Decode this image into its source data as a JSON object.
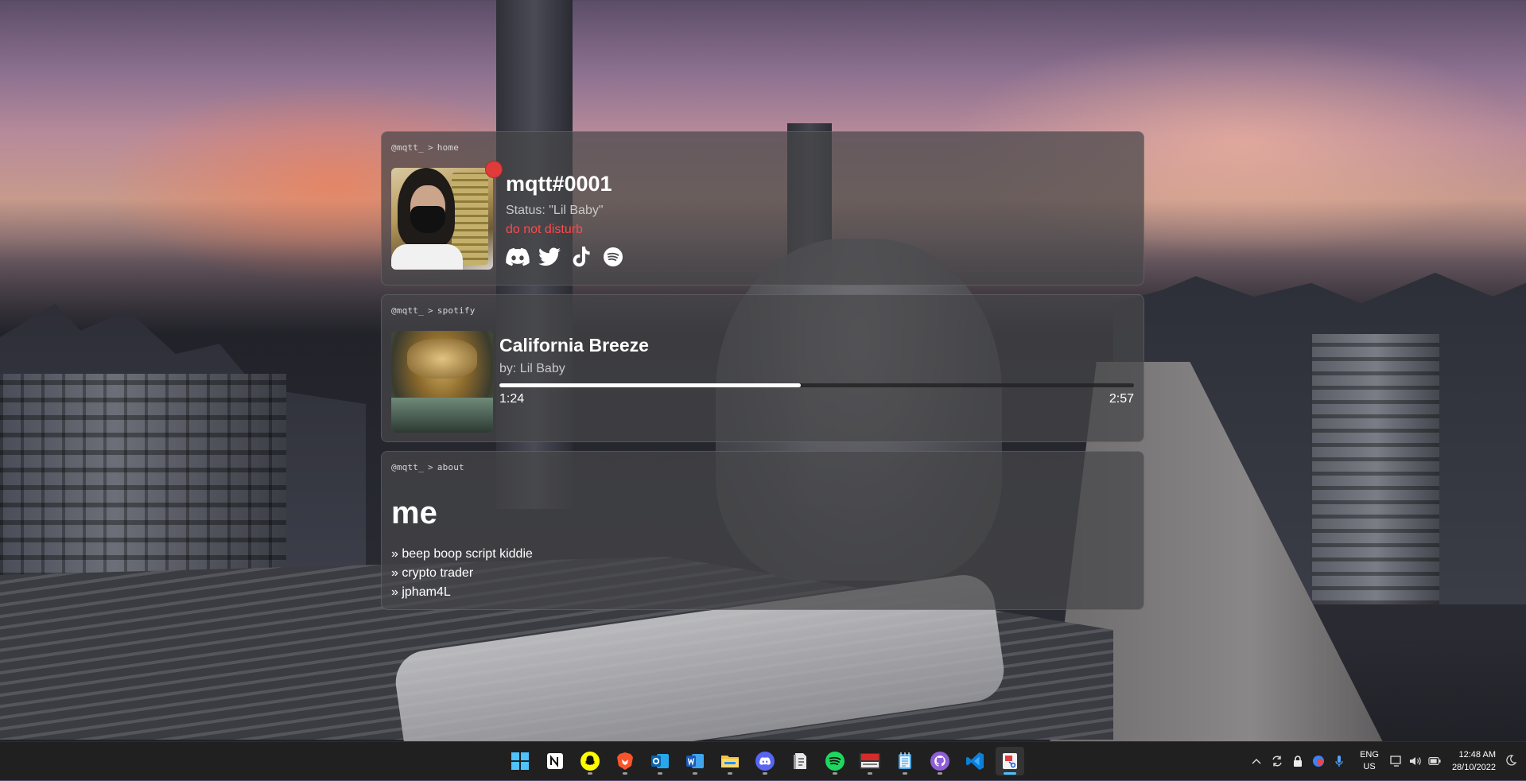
{
  "home": {
    "breadcrumb_user": "@mqtt_",
    "breadcrumb_sep": ">",
    "breadcrumb_page": "home",
    "username": "mqtt#0001",
    "status": "Status: \"Lil Baby\"",
    "presence": "do not disturb",
    "presence_color": "#ff4a4a",
    "socials": [
      "discord-icon",
      "twitter-icon",
      "tiktok-icon",
      "spotify-icon"
    ]
  },
  "spotify": {
    "breadcrumb_user": "@mqtt_",
    "breadcrumb_sep": ">",
    "breadcrumb_page": "spotify",
    "track_title": "California Breeze",
    "artist": "by: Lil Baby",
    "current_time": "1:24",
    "total_time": "2:57",
    "progress_fraction": 0.475
  },
  "about": {
    "breadcrumb_user": "@mqtt_",
    "breadcrumb_sep": ">",
    "breadcrumb_page": "about",
    "title": "me",
    "items": [
      "» beep boop script kiddie",
      "» crypto trader",
      "» jpham4L"
    ]
  },
  "taskbar": {
    "apps": [
      "windows-start-icon",
      "notion-icon",
      "snapchat-icon",
      "brave-icon",
      "outlook-icon",
      "word-icon",
      "file-explorer-icon",
      "discord-icon",
      "notes-icon",
      "spotify-icon",
      "voicemeeter-icon",
      "notepad-icon",
      "github-desktop-icon",
      "vscode-icon",
      "snipping-tool-icon"
    ],
    "lang_top": "ENG",
    "lang_bottom": "US",
    "time": "12:48 AM",
    "date": "28/10/2022"
  }
}
